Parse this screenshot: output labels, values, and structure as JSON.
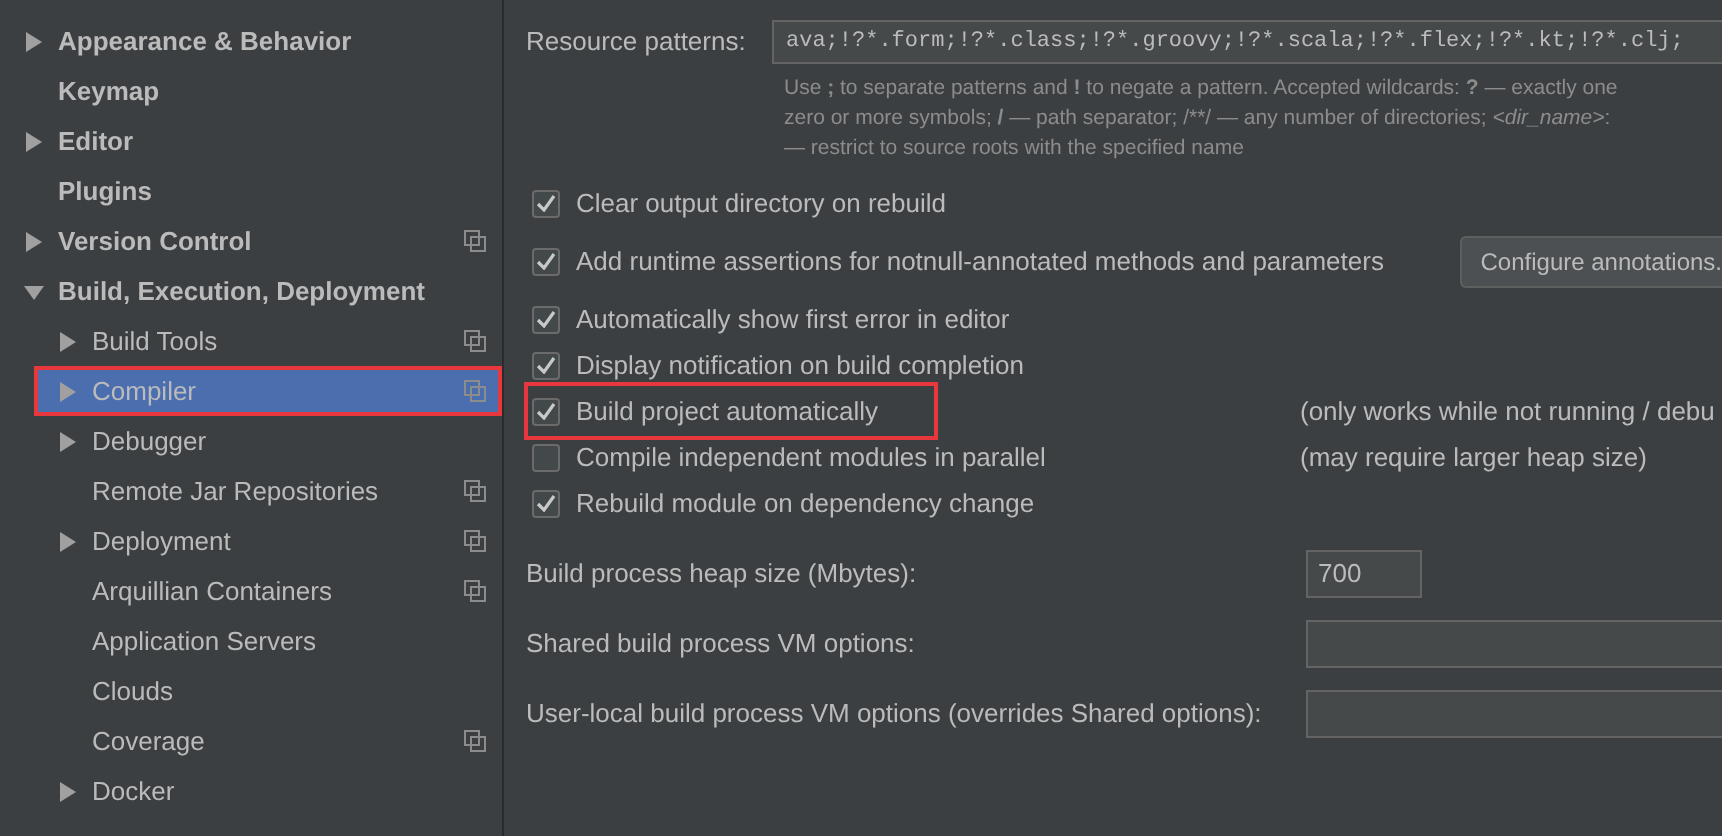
{
  "sidebar": {
    "items": [
      {
        "label": "Appearance & Behavior",
        "kind": "group",
        "expanded": false,
        "copy_icon": false,
        "selected": false,
        "highlighted": false
      },
      {
        "label": "Keymap",
        "kind": "leaf",
        "copy_icon": false,
        "selected": false,
        "highlighted": false
      },
      {
        "label": "Editor",
        "kind": "group",
        "expanded": false,
        "copy_icon": false,
        "selected": false,
        "highlighted": false
      },
      {
        "label": "Plugins",
        "kind": "leaf",
        "copy_icon": false,
        "selected": false,
        "highlighted": false
      },
      {
        "label": "Version Control",
        "kind": "group",
        "expanded": false,
        "copy_icon": true,
        "selected": false,
        "highlighted": false
      },
      {
        "label": "Build, Execution, Deployment",
        "kind": "group",
        "expanded": true,
        "copy_icon": false,
        "selected": false,
        "highlighted": false,
        "children": [
          {
            "label": "Build Tools",
            "kind": "group",
            "expanded": false,
            "copy_icon": true,
            "selected": false,
            "highlighted": false
          },
          {
            "label": "Compiler",
            "kind": "group",
            "expanded": false,
            "copy_icon": true,
            "selected": true,
            "highlighted": true
          },
          {
            "label": "Debugger",
            "kind": "group",
            "expanded": false,
            "copy_icon": false,
            "selected": false,
            "highlighted": false
          },
          {
            "label": "Remote Jar Repositories",
            "kind": "leaf",
            "copy_icon": true,
            "selected": false,
            "highlighted": false
          },
          {
            "label": "Deployment",
            "kind": "group",
            "expanded": false,
            "copy_icon": true,
            "selected": false,
            "highlighted": false
          },
          {
            "label": "Arquillian Containers",
            "kind": "leaf",
            "copy_icon": true,
            "selected": false,
            "highlighted": false
          },
          {
            "label": "Application Servers",
            "kind": "leaf",
            "copy_icon": false,
            "selected": false,
            "highlighted": false
          },
          {
            "label": "Clouds",
            "kind": "leaf",
            "copy_icon": false,
            "selected": false,
            "highlighted": false
          },
          {
            "label": "Coverage",
            "kind": "leaf",
            "copy_icon": true,
            "selected": false,
            "highlighted": false
          },
          {
            "label": "Docker",
            "kind": "group",
            "expanded": false,
            "copy_icon": false,
            "selected": false,
            "highlighted": false
          }
        ]
      }
    ]
  },
  "resource_patterns": {
    "label": "Resource patterns:",
    "value": "ava;!?*.form;!?*.class;!?*.groovy;!?*.scala;!?*.flex;!?*.kt;!?*.clj;",
    "hint": [
      "Use **;** to separate patterns and **!** to negate a pattern. Accepted wildcards: **?** — exactly one",
      "zero or more symbols; **/** — path separator; /**/ — any number of directories; *<dir_name>*:",
      "— restrict to source roots with the specified name"
    ]
  },
  "options": [
    {
      "label": "Clear output directory on rebuild",
      "checked": true,
      "highlighted": false
    },
    {
      "label": "Add runtime assertions for notnull-annotated methods and parameters",
      "checked": true,
      "highlighted": false,
      "button": "Configure annotations."
    },
    {
      "label": "Automatically show first error in editor",
      "checked": true,
      "highlighted": false
    },
    {
      "label": "Display notification on build completion",
      "checked": true,
      "highlighted": false
    },
    {
      "label": "Build project automatically",
      "checked": true,
      "highlighted": true,
      "note": "(only works while not running / debu"
    },
    {
      "label": "Compile independent modules in parallel",
      "checked": false,
      "highlighted": false,
      "note": "(may require larger heap size)"
    },
    {
      "label": "Rebuild module on dependency change",
      "checked": true,
      "highlighted": false
    }
  ],
  "fields": [
    {
      "label": "Build process heap size (Mbytes):",
      "value": "700",
      "kind": "short"
    },
    {
      "label": "Shared build process VM options:",
      "kind": "wide"
    },
    {
      "label": "User-local build process VM options (overrides Shared options):",
      "kind": "wide"
    }
  ]
}
